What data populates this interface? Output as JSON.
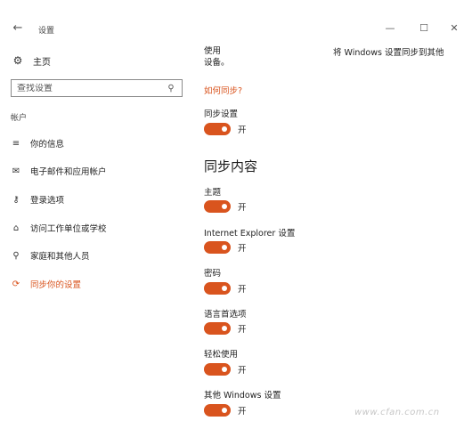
{
  "window": {
    "title": "设置",
    "back_glyph": "←",
    "min_glyph": "—",
    "max_glyph": "☐",
    "close_glyph": "✕"
  },
  "sidebar": {
    "home": {
      "icon": "gear-icon",
      "glyph": "⚙",
      "label": "主页"
    },
    "search": {
      "placeholder": "查找设置",
      "icon": "search-icon",
      "glyph": "⚲"
    },
    "section_label": "帐户",
    "items": [
      {
        "name": "your-info",
        "icon": "person-card-icon",
        "glyph": "≡",
        "label": "你的信息",
        "active": false
      },
      {
        "name": "email-accounts",
        "icon": "mail-icon",
        "glyph": "✉",
        "label": "电子邮件和应用帐户",
        "active": false
      },
      {
        "name": "sign-in-options",
        "icon": "key-icon",
        "glyph": "⚷",
        "label": "登录选项",
        "active": false
      },
      {
        "name": "access-work-school",
        "icon": "briefcase-icon",
        "glyph": "⌂",
        "label": "访问工作单位或学校",
        "active": false
      },
      {
        "name": "family-other-users",
        "icon": "person-icon",
        "glyph": "⚲",
        "label": "家庭和其他人员",
        "active": false
      },
      {
        "name": "sync-settings",
        "icon": "sync-icon",
        "glyph": "⟳",
        "label": "同步你的设置",
        "active": true
      }
    ]
  },
  "main": {
    "desc_line1": "使用",
    "desc_line2": "设备。",
    "desc_right": "将 Windows 设置同步到其他",
    "how_link": "如何同步?",
    "sync_settings": {
      "label": "同步设置",
      "state": "开"
    },
    "heading": "同步内容",
    "toggles": [
      {
        "label": "主题",
        "state": "开"
      },
      {
        "label": "Internet Explorer 设置",
        "state": "开"
      },
      {
        "label": "密码",
        "state": "开"
      },
      {
        "label": "语言首选项",
        "state": "开"
      },
      {
        "label": "轻松使用",
        "state": "开"
      },
      {
        "label": "其他 Windows 设置",
        "state": "开"
      }
    ]
  },
  "watermark": "www.cfan.com.cn",
  "colors": {
    "accent": "#d9541e",
    "text": "#1f1f1f",
    "background": "#ffffff"
  }
}
